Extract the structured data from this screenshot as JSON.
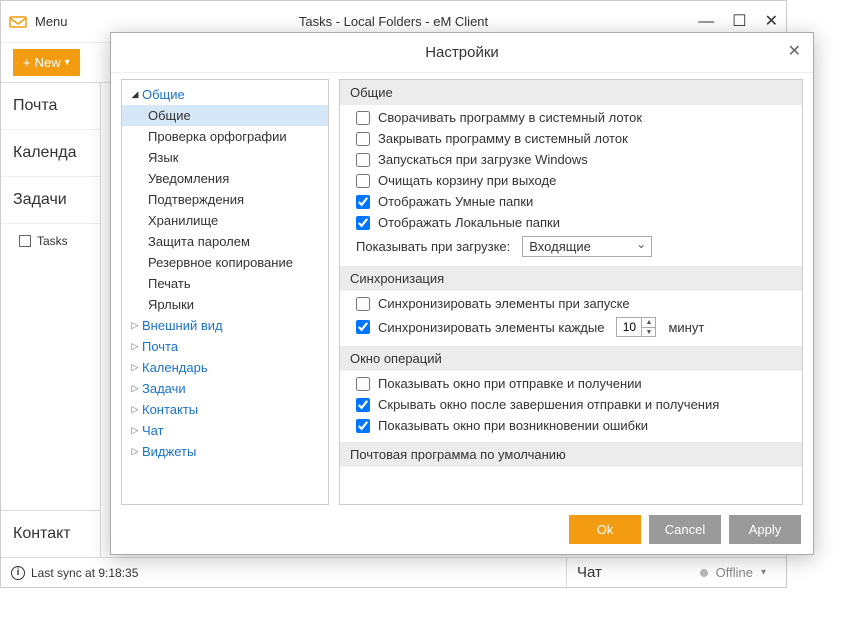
{
  "main": {
    "menu_label": "Menu",
    "title": "Tasks - Local Folders - eM Client",
    "new_button": "New",
    "nav": {
      "mail": "Почта",
      "calendar": "Календа",
      "tasks": "Задачи",
      "tasks_item": "Tasks",
      "contacts": "Контакт"
    },
    "status": {
      "last_sync": "Last sync at 9:18:35",
      "chat_label": "Чат",
      "offline": "Offline"
    }
  },
  "modal": {
    "title": "Настройки",
    "tree": {
      "general": "Общие",
      "general_children": [
        "Общие",
        "Проверка орфографии",
        "Язык",
        "Уведомления",
        "Подтверждения",
        "Хранилище",
        "Защита паролем",
        "Резервное копирование",
        "Печать",
        "Ярлыки"
      ],
      "appearance": "Внешний вид",
      "mail": "Почта",
      "calendar": "Календарь",
      "tasks": "Задачи",
      "contacts": "Контакты",
      "chat": "Чат",
      "widgets": "Виджеты"
    },
    "sections": {
      "general": {
        "title": "Общие",
        "minimize_tray": "Сворачивать программу в системный лоток",
        "close_tray": "Закрывать программу в системный лоток",
        "run_startup": "Запускаться при загрузке Windows",
        "empty_trash": "Очищать корзину при выходе",
        "show_smart": "Отображать Умные папки",
        "show_local": "Отображать Локальные папки",
        "show_on_load": "Показывать при загрузке:",
        "show_on_load_value": "Входящие"
      },
      "sync": {
        "title": "Синхронизация",
        "sync_startup": "Синхронизировать элементы при запуске",
        "sync_every": "Синхронизировать элементы каждые",
        "interval": "10",
        "unit": "минут"
      },
      "ops": {
        "title": "Окно операций",
        "show_sendrecv": "Показывать окно при отправке и получении",
        "hide_after": "Скрывать окно после завершения отправки и получения",
        "show_error": "Показывать окно при возникновении ошибки"
      },
      "default_mail": {
        "title": "Почтовая программа по умолчанию"
      }
    },
    "buttons": {
      "ok": "Ok",
      "cancel": "Cancel",
      "apply": "Apply"
    }
  }
}
